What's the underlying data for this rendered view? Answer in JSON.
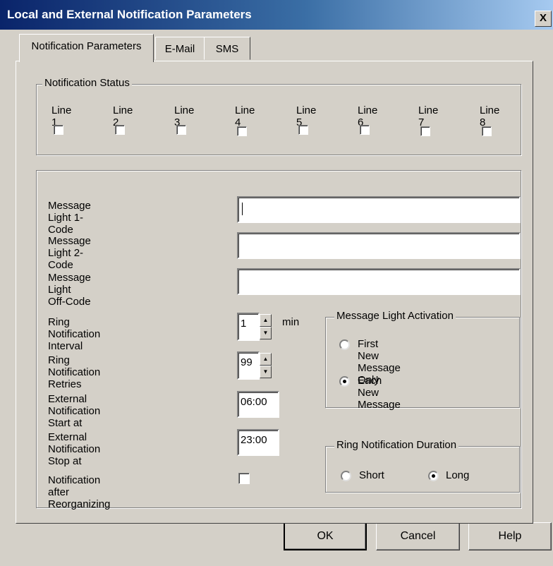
{
  "window": {
    "title": "Local and External Notification Parameters",
    "close_glyph": "X"
  },
  "tabs": [
    {
      "label": "Notification Parameters",
      "active": true
    },
    {
      "label": "E-Mail",
      "active": false
    },
    {
      "label": "SMS",
      "active": false
    }
  ],
  "notification_status": {
    "legend": "Notification Status",
    "lines": [
      {
        "label": "Line 1",
        "checked": false
      },
      {
        "label": "Line 2",
        "checked": false
      },
      {
        "label": "Line 3",
        "checked": false
      },
      {
        "label": "Line 4",
        "checked": false
      },
      {
        "label": "Line 5",
        "checked": false
      },
      {
        "label": "Line 6",
        "checked": false
      },
      {
        "label": "Line 7",
        "checked": false
      },
      {
        "label": "Line 8",
        "checked": false
      }
    ]
  },
  "fields": {
    "msg_light_1": {
      "label": "Message Light 1-Code",
      "value": ""
    },
    "msg_light_2": {
      "label": "Message Light 2-Code",
      "value": ""
    },
    "msg_light_off": {
      "label": "Message Light Off-Code",
      "value": ""
    },
    "ring_interval": {
      "label": "Ring Notification Interval",
      "value": "1",
      "unit": "min"
    },
    "ring_retries": {
      "label": "Ring Notification Retries",
      "value": "99"
    },
    "ext_start": {
      "label": "External Notification Start at",
      "value": "06:00"
    },
    "ext_stop": {
      "label": "External Notification Stop at",
      "value": "23:00"
    },
    "reorg": {
      "label": "Notification after Reorganizing",
      "checked": false
    }
  },
  "message_light_activation": {
    "legend": "Message Light Activation",
    "options": [
      {
        "label": "First New Message Only",
        "selected": false
      },
      {
        "label": "Each New Message",
        "selected": true
      }
    ]
  },
  "ring_duration": {
    "legend": "Ring Notification Duration",
    "options": [
      {
        "label": "Short",
        "selected": false
      },
      {
        "label": "Long",
        "selected": true
      }
    ]
  },
  "buttons": {
    "ok": "OK",
    "cancel": "Cancel",
    "help": "Help"
  }
}
